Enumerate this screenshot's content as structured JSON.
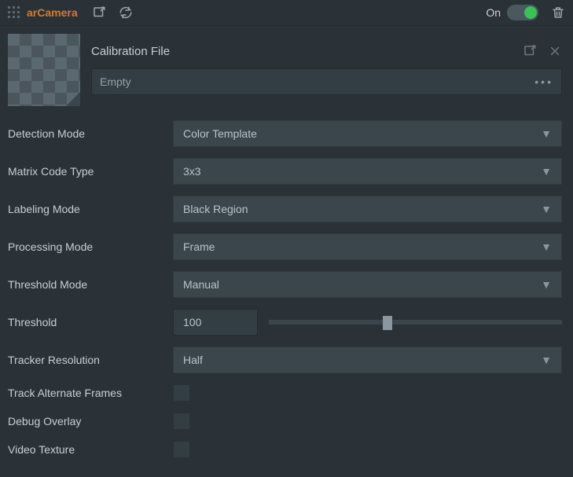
{
  "header": {
    "title": "arCamera",
    "on_label": "On",
    "enabled": true
  },
  "calibration": {
    "label": "Calibration File",
    "value": "Empty"
  },
  "props": {
    "detection_mode": {
      "label": "Detection Mode",
      "value": "Color Template"
    },
    "matrix_code_type": {
      "label": "Matrix Code Type",
      "value": "3x3"
    },
    "labeling_mode": {
      "label": "Labeling Mode",
      "value": "Black Region"
    },
    "processing_mode": {
      "label": "Processing Mode",
      "value": "Frame"
    },
    "threshold_mode": {
      "label": "Threshold Mode",
      "value": "Manual"
    },
    "threshold": {
      "label": "Threshold",
      "value": "100"
    },
    "tracker_resolution": {
      "label": "Tracker Resolution",
      "value": "Half"
    },
    "track_alternate_frames": {
      "label": "Track Alternate Frames",
      "value": false
    },
    "debug_overlay": {
      "label": "Debug Overlay",
      "value": false
    },
    "video_texture": {
      "label": "Video Texture",
      "value": false
    }
  }
}
